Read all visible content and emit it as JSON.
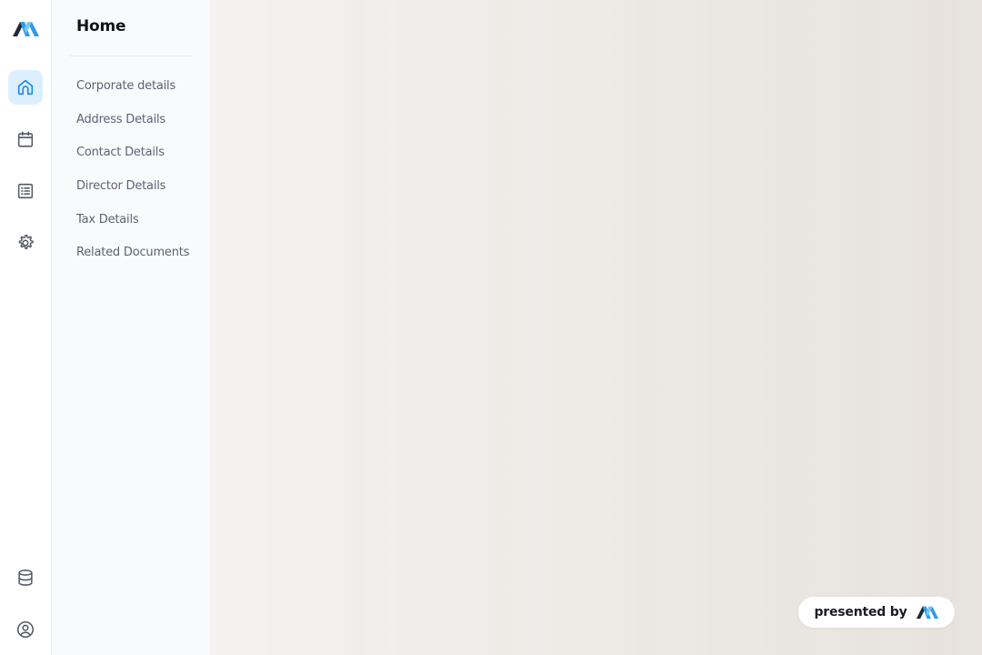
{
  "brand": {
    "logo_icon": "logo-icon",
    "colors": {
      "logo_dark": "#1f2a37",
      "logo_blue": "#2f9be8",
      "logo_light_blue": "#7cc6f6",
      "active_bg": "#dcefff",
      "active_icon": "#1d8be0"
    }
  },
  "rail": {
    "items": [
      {
        "id": "home",
        "icon": "home-icon",
        "active": true
      },
      {
        "id": "calendar",
        "icon": "calendar-icon",
        "active": false
      },
      {
        "id": "list",
        "icon": "list-icon",
        "active": false
      },
      {
        "id": "settings",
        "icon": "gear-icon",
        "active": false
      },
      {
        "id": "database",
        "icon": "database-icon",
        "active": false
      },
      {
        "id": "profile",
        "icon": "user-circle-icon",
        "active": false
      }
    ]
  },
  "subnav": {
    "title": "Home",
    "items": [
      {
        "label": "Corporate details"
      },
      {
        "label": "Address Details"
      },
      {
        "label": "Contact Details"
      },
      {
        "label": "Director Details"
      },
      {
        "label": "Tax Details"
      },
      {
        "label": "Related Documents"
      }
    ]
  },
  "footer_badge": {
    "label": "presented by",
    "icon": "logo-icon"
  }
}
